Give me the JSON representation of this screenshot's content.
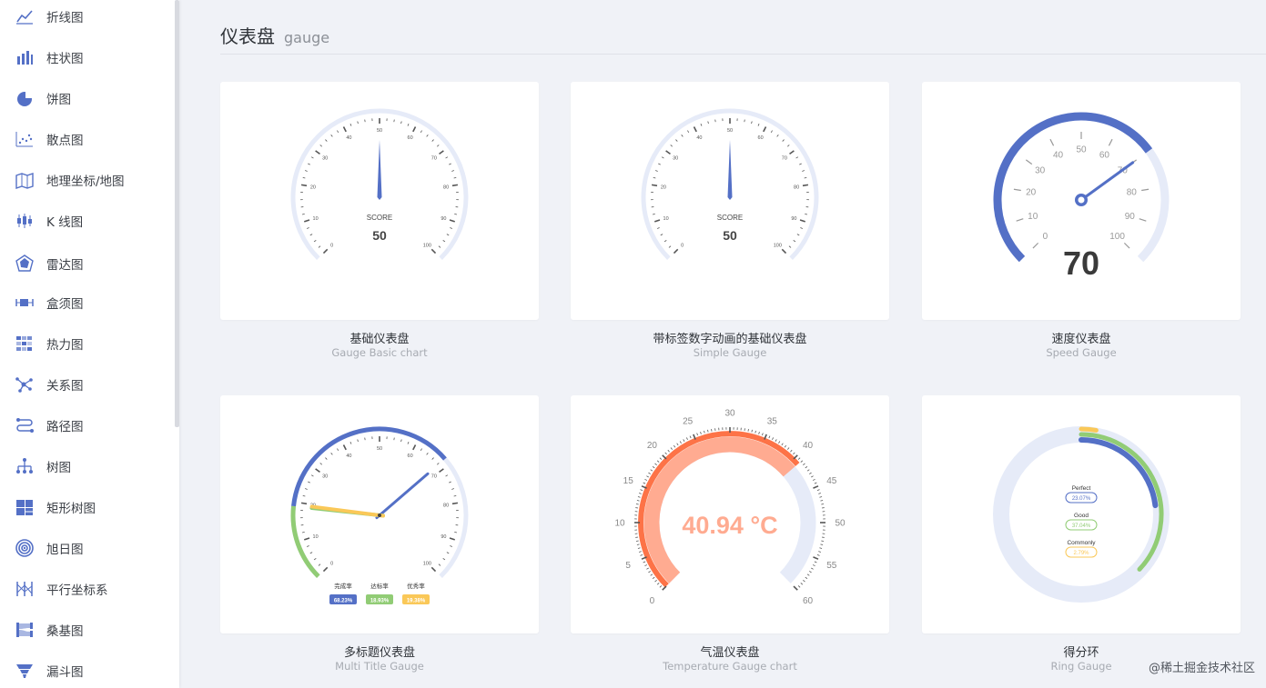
{
  "sidebar": {
    "items": [
      {
        "label": "折线图",
        "icon": "line-chart-icon"
      },
      {
        "label": "柱状图",
        "icon": "bar-chart-icon"
      },
      {
        "label": "饼图",
        "icon": "pie-chart-icon"
      },
      {
        "label": "散点图",
        "icon": "scatter-chart-icon"
      },
      {
        "label": "地理坐标/地图",
        "icon": "map-icon"
      },
      {
        "label": "K 线图",
        "icon": "candlestick-icon"
      },
      {
        "label": "雷达图",
        "icon": "radar-icon"
      },
      {
        "label": "盒须图",
        "icon": "boxplot-icon"
      },
      {
        "label": "热力图",
        "icon": "heatmap-icon"
      },
      {
        "label": "关系图",
        "icon": "graph-icon"
      },
      {
        "label": "路径图",
        "icon": "lines-icon"
      },
      {
        "label": "树图",
        "icon": "tree-icon"
      },
      {
        "label": "矩形树图",
        "icon": "treemap-icon"
      },
      {
        "label": "旭日图",
        "icon": "sunburst-icon"
      },
      {
        "label": "平行坐标系",
        "icon": "parallel-icon"
      },
      {
        "label": "桑基图",
        "icon": "sankey-icon"
      },
      {
        "label": "漏斗图",
        "icon": "funnel-icon"
      }
    ]
  },
  "page": {
    "title": "仪表盘",
    "subtitle": "gauge"
  },
  "cards": [
    {
      "title": "基础仪表盘",
      "subtitle": "Gauge Basic chart"
    },
    {
      "title": "带标签数字动画的基础仪表盘",
      "subtitle": "Simple Gauge"
    },
    {
      "title": "速度仪表盘",
      "subtitle": "Speed Gauge"
    },
    {
      "title": "多标题仪表盘",
      "subtitle": "Multi Title Gauge"
    },
    {
      "title": "气温仪表盘",
      "subtitle": "Temperature Gauge chart"
    },
    {
      "title": "得分环",
      "subtitle": "Ring Gauge"
    }
  ],
  "watermark": "@稀土掘金技术社区",
  "colors": {
    "accent": "#5470c6",
    "green": "#91cc75",
    "yellow": "#fac858",
    "orange": "#fd7347",
    "track": "#e6ebf8"
  },
  "chart_data": [
    {
      "type": "gauge",
      "min": 0,
      "max": 100,
      "ticks": [
        "0",
        "10",
        "20",
        "30",
        "40",
        "50",
        "60",
        "70",
        "80",
        "90",
        "100"
      ],
      "detail_title": "SCORE",
      "value": 50
    },
    {
      "type": "gauge",
      "min": 0,
      "max": 100,
      "ticks": [
        "0",
        "10",
        "20",
        "30",
        "40",
        "50",
        "60",
        "70",
        "80",
        "90",
        "100"
      ],
      "detail_title": "SCORE",
      "value": 50
    },
    {
      "type": "gauge",
      "min": 0,
      "max": 100,
      "ticks": [
        "0",
        "10",
        "20",
        "30",
        "40",
        "50",
        "60",
        "70",
        "80",
        "90",
        "100"
      ],
      "value": 70
    },
    {
      "type": "gauge",
      "min": 0,
      "max": 100,
      "ticks": [
        "0",
        "10",
        "20",
        "30",
        "40",
        "50",
        "60",
        "70",
        "80",
        "90",
        "100"
      ],
      "series": [
        {
          "name": "完成率",
          "value": "68.23%",
          "color": "#5470c6"
        },
        {
          "name": "达标率",
          "value": "18.93%",
          "color": "#91cc75"
        },
        {
          "name": "优秀率",
          "value": "19.38%",
          "color": "#fac858"
        }
      ]
    },
    {
      "type": "gauge",
      "min": 0,
      "max": 60,
      "ticks": [
        "0",
        "5",
        "10",
        "15",
        "20",
        "25",
        "30",
        "35",
        "40",
        "45",
        "50",
        "55",
        "60"
      ],
      "value": 40.94,
      "value_label": "40.94 °C"
    },
    {
      "type": "gauge",
      "min": 0,
      "max": 100,
      "series": [
        {
          "name": "Perfect",
          "value": "23.07%",
          "color": "#5470c6"
        },
        {
          "name": "Good",
          "value": "37.04%",
          "color": "#91cc75"
        },
        {
          "name": "Commonly",
          "value": "2.79%",
          "color": "#fac858"
        }
      ]
    }
  ]
}
